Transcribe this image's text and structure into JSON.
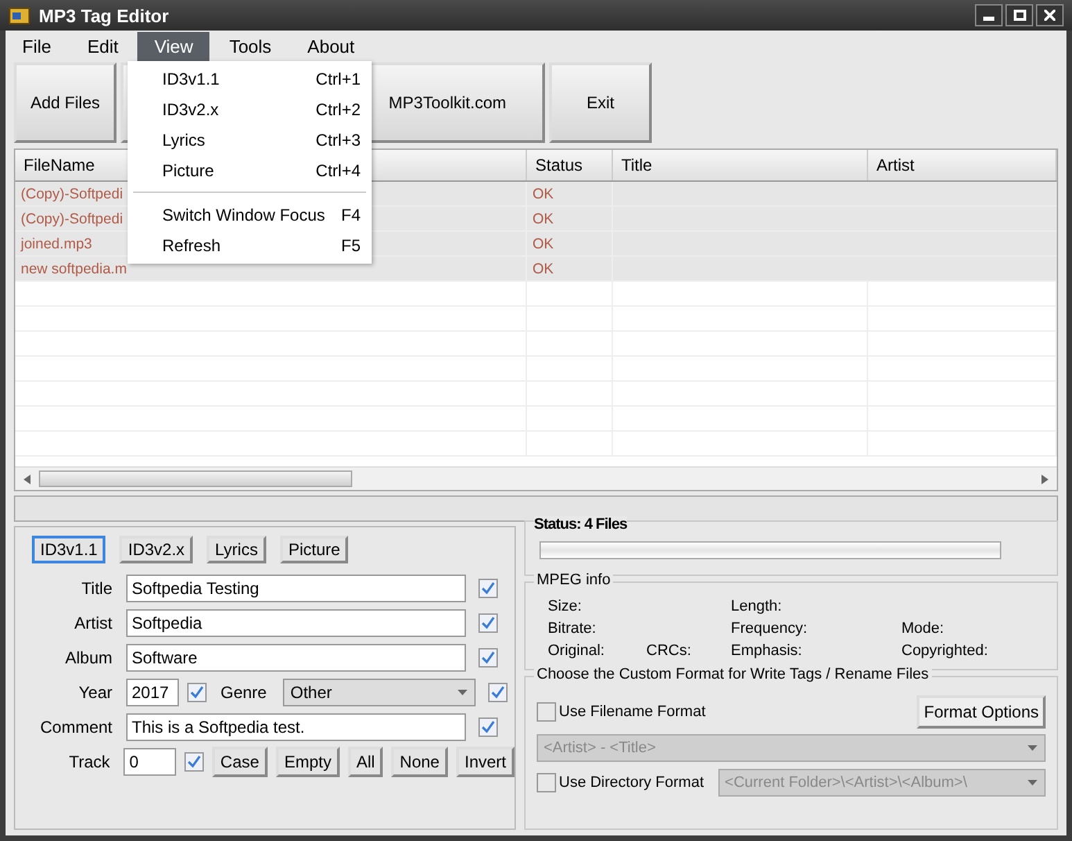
{
  "window": {
    "title": "MP3 Tag Editor"
  },
  "menu": [
    {
      "label": "File",
      "selected": false
    },
    {
      "label": "Edit",
      "selected": false
    },
    {
      "label": "View",
      "selected": true
    },
    {
      "label": "Tools",
      "selected": false
    },
    {
      "label": "About",
      "selected": false
    }
  ],
  "open_menu": [
    {
      "kind": "item",
      "label": "ID3v1.1",
      "shortcut": "Ctrl+1"
    },
    {
      "kind": "item",
      "label": "ID3v2.x",
      "shortcut": "Ctrl+2"
    },
    {
      "kind": "item",
      "label": "Lyrics",
      "shortcut": "Ctrl+3"
    },
    {
      "kind": "item",
      "label": "Picture",
      "shortcut": "Ctrl+4"
    },
    {
      "kind": "separator"
    },
    {
      "kind": "item",
      "label": "Switch Window Focus",
      "shortcut": "F4"
    },
    {
      "kind": "item",
      "label": "Refresh",
      "shortcut": "F5"
    }
  ],
  "toolbar": [
    {
      "kind": "left",
      "label": "Add Files"
    },
    {
      "kind": "wide",
      "label": "MP3Toolkit.com"
    },
    {
      "kind": "left",
      "label": "Exit"
    }
  ],
  "table": {
    "columns": [
      "FileName",
      "Status",
      "Title",
      "Artist"
    ],
    "rows": [
      {
        "cells": [
          "(Copy)-Softpedi",
          "OK"
        ]
      },
      {
        "cells": [
          "(Copy)-Softpedi",
          "OK"
        ]
      },
      {
        "cells": [
          "joined.mp3",
          "OK"
        ]
      },
      {
        "cells": [
          "new softpedia.m",
          "OK"
        ]
      }
    ]
  },
  "tag_tabs": [
    {
      "label": "ID3v1.1",
      "selected": true
    },
    {
      "label": "ID3v2.x",
      "selected": false
    },
    {
      "label": "Lyrics",
      "selected": false
    },
    {
      "label": "Picture",
      "selected": false
    }
  ],
  "fields": [
    {
      "kind": "text",
      "label": "Title",
      "value": "Softpedia Testing",
      "checked": true
    },
    {
      "kind": "text",
      "label": "Artist",
      "value": "Softpedia",
      "checked": true
    },
    {
      "kind": "text",
      "label": "Album",
      "value": "Software",
      "checked": true
    },
    {
      "kind": "year",
      "label": "Year",
      "value": "2017",
      "checked": true,
      "genre_label": "Genre",
      "genre": "Other",
      "genre_checked": true
    },
    {
      "kind": "text",
      "label": "Comment",
      "value": "This is a Softpedia test.",
      "checked": true
    },
    {
      "kind": "track",
      "label": "Track",
      "value": "0",
      "checked": true,
      "buttons": [
        "Case",
        "Empty",
        "All",
        "None",
        "Invert"
      ]
    }
  ],
  "status": {
    "label": "Status: 4 Files",
    "level": 0
  },
  "mpeg_info": {
    "title": "MPEG info",
    "rows": [
      [
        "Size:",
        null,
        "Length:",
        null
      ],
      [
        "Bitrate:",
        null,
        "Frequency:",
        "Mode:"
      ],
      [
        "Original:",
        "CRCs:",
        "Emphasis:",
        "Copyrighted:"
      ]
    ]
  },
  "custom_format": {
    "title": "Choose the Custom Format for Write Tags / Rename Files",
    "filename_format": {
      "label": "Use Filename Format",
      "checked": false,
      "value": "<Artist> - <Title>"
    },
    "options_button": "Format Options",
    "directory_format": {
      "label": "Use Directory Format",
      "checked": false,
      "value": "<Current Folder>\\<Artist>\\<Album>\\"
    }
  }
}
